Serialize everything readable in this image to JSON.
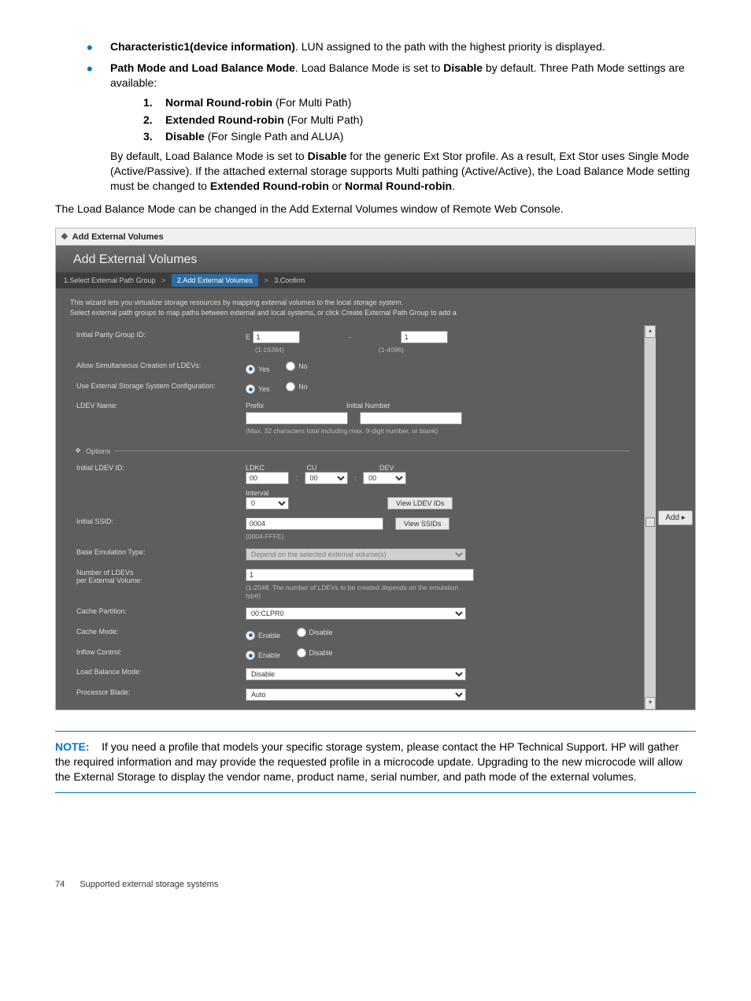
{
  "bullets": {
    "b1_strong": "Characteristic1(device information)",
    "b1_rest": ". LUN assigned to the path with the highest priority is displayed.",
    "b2_strong": "Path Mode and Load Balance Mode",
    "b2_rest_a": ". Load Balance Mode is set to ",
    "b2_disable": "Disable",
    "b2_rest_b": " by default. Three Path Mode settings are available:",
    "ol": [
      {
        "n": "1.",
        "strong": "Normal Round-robin",
        "rest": " (For Multi Path)"
      },
      {
        "n": "2.",
        "strong": "Extended Round-robin",
        "rest": " (For Multi Path)"
      },
      {
        "n": "3.",
        "strong": "Disable",
        "rest": " (For Single Path and ALUA)"
      }
    ],
    "para_a": "By default, Load Balance Mode is set to ",
    "para_disable": "Disable",
    "para_b": " for the generic Ext Stor profile. As a result, Ext Stor uses Single Mode (Active/Passive). If the attached external storage supports Multi pathing (Active/Active), the Load Balance Mode setting must be changed to ",
    "para_ext": "Extended Round-robin",
    "para_or": " or ",
    "para_norm": "Normal Round-robin",
    "para_dot": "."
  },
  "lead": "The Load Balance Mode can be changed in the Add External Volumes window of Remote Web Console.",
  "dlg": {
    "title": "Add External Volumes",
    "header": "Add External Volumes",
    "steps": {
      "s1": "1.Select External Path Group",
      "s2": "2.Add External Volumes",
      "s3": "3.Confirm"
    },
    "desc1": "This wizard lets you virtualize storage resources by mapping external volumes to the local storage system.",
    "desc2": "Select external path groups to map paths between external and local systems, or click Create External Path Group to add a",
    "rows": {
      "pg_label": "Initial Parity Group ID:",
      "pg_prefix": "E",
      "pg_v1": "1",
      "pg_v2": "1",
      "pg_hint1": "(1-16384)",
      "pg_hint2": "(1-4096)",
      "allow_label": "Allow Simultaneous Creation of LDEVs:",
      "yes": "Yes",
      "no": "No",
      "useext_label": "Use External Storage System Configuration:",
      "ldevname_label": "LDEV Name:",
      "prefix": "Prefix",
      "initnum": "Initial Number",
      "ldevname_hint": "(Max. 32 characters total including max. 9-digit number, or blank)",
      "options": "Options",
      "initldev_label": "Initial LDEV ID:",
      "ldkc": "LDKC",
      "cu": "CU",
      "dev": "DEV",
      "ldkc_v": "00",
      "cu_v": "00",
      "dev_v": "00",
      "interval": "Interval",
      "interval_v": "0",
      "viewldev": "View LDEV IDs",
      "initssid_label": "Initial SSID:",
      "ssid_v": "0004",
      "ssid_hint": "(0004-FFFE)",
      "viewssids": "View SSIDs",
      "emul_label": "Base Emulation Type:",
      "emul_v": "Depend on the selected external volume(s)",
      "numldev_label1": "Number of LDEVs",
      "numldev_label2": "per External Volume:",
      "numldev_v": "1",
      "numldev_hint": "(1-2048. The number of LDEVs to be created depends on the emulation type)",
      "cachepart_label": "Cache Partition:",
      "cachepart_v": "00:CLPR0",
      "cachemode_label": "Cache Mode:",
      "enable": "Enable",
      "disable": "Disable",
      "inflow_label": "Inflow Control:",
      "lb_label": "Load Balance Mode:",
      "lb_v": "Disable",
      "proc_label": "Processor Blade:",
      "proc_v": "Auto"
    },
    "add_btn": "Add ▸"
  },
  "note": {
    "label": "NOTE:",
    "text": "If you need a profile that models your specific storage system, please contact the HP Technical Support. HP will gather the required information and may provide the requested profile in a microcode update. Upgrading to the new microcode will allow the External Storage to display the vendor name, product name, serial number, and path mode of the external volumes."
  },
  "footer": {
    "page": "74",
    "section": "Supported external storage systems"
  }
}
